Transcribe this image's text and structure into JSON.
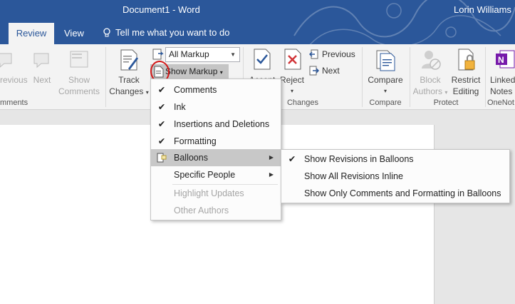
{
  "window": {
    "title": "Document1 - Word",
    "user": "Lorin Williams"
  },
  "tabs": {
    "review": "Review",
    "view": "View",
    "tell_me": "Tell me what you want to do"
  },
  "ribbon": {
    "comments_group": {
      "previous": "revious",
      "next": "Next",
      "show_comments_line1": "Show",
      "show_comments_line2": "Comments",
      "label": "mments"
    },
    "tracking_group": {
      "track_changes_line1": "Track",
      "track_changes_line2": "Changes",
      "markup_value": "All Markup",
      "show_markup": "Show Markup"
    },
    "changes_group": {
      "accept": "Accept",
      "reject": "Reject",
      "previous": "Previous",
      "next": "Next",
      "label": "Changes"
    },
    "compare_group": {
      "compare": "Compare",
      "label": "Compare"
    },
    "protect_group": {
      "block_authors_line1": "Block",
      "block_authors_line2": "Authors",
      "restrict_editing_line1": "Restrict",
      "restrict_editing_line2": "Editing",
      "label": "Protect"
    },
    "onenote_group": {
      "linked_notes_line1": "Linked",
      "linked_notes_line2": "Notes",
      "label": "OneNot"
    }
  },
  "show_markup_menu": {
    "items": [
      {
        "label": "Comments",
        "checked": "✔"
      },
      {
        "label": "Ink",
        "checked": "✔"
      },
      {
        "label": "Insertions and Deletions",
        "checked": "✔"
      },
      {
        "label": "Formatting",
        "checked": "✔"
      },
      {
        "label": "Balloons",
        "checked": ""
      },
      {
        "label": "Specific People",
        "checked": ""
      },
      {
        "label": "Highlight Updates",
        "checked": ""
      },
      {
        "label": "Other Authors",
        "checked": ""
      }
    ]
  },
  "balloons_submenu": {
    "items": [
      {
        "label": "Show Revisions in Balloons",
        "checked": "✔"
      },
      {
        "label": "Show All Revisions Inline",
        "checked": ""
      },
      {
        "label": "Show Only Comments and Formatting in Balloons",
        "checked": ""
      }
    ]
  },
  "colors": {
    "brand": "#2b579a",
    "annotation": "#d21818",
    "onenote": "#7719aa"
  }
}
